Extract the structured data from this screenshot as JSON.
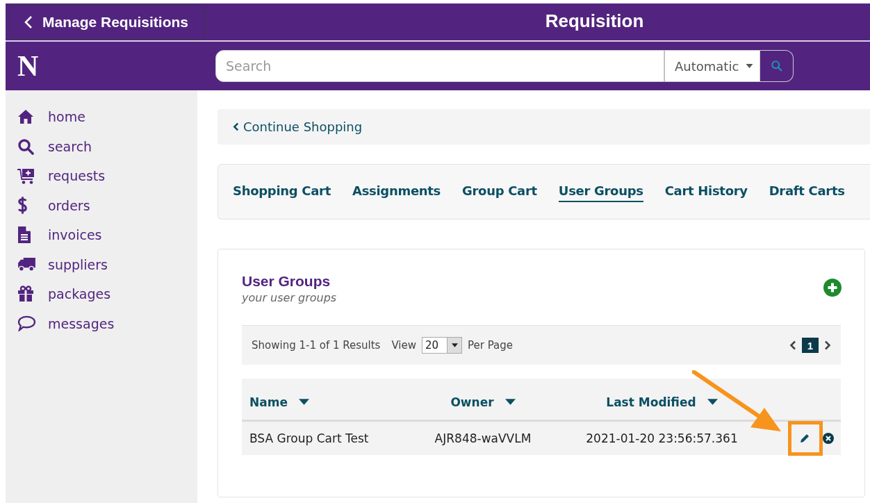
{
  "header": {
    "back_label": "Manage Requisitions",
    "title": "Requisition"
  },
  "logo": "N",
  "search": {
    "placeholder": "Search",
    "mode": "Automatic"
  },
  "sidebar": {
    "items": [
      {
        "label": "home",
        "kind": "home"
      },
      {
        "label": "search",
        "kind": "search"
      },
      {
        "label": "requests",
        "kind": "cart"
      },
      {
        "label": "orders",
        "kind": "dollar"
      },
      {
        "label": "invoices",
        "kind": "document"
      },
      {
        "label": "suppliers",
        "kind": "truck"
      },
      {
        "label": "packages",
        "kind": "gift"
      },
      {
        "label": "messages",
        "kind": "chat"
      }
    ]
  },
  "breadcrumb": "Continue Shopping",
  "tabs": [
    {
      "label": "Shopping Cart",
      "selected": false
    },
    {
      "label": "Assignments",
      "selected": false
    },
    {
      "label": "Group Cart",
      "selected": false
    },
    {
      "label": "User Groups",
      "selected": true
    },
    {
      "label": "Cart History",
      "selected": false
    },
    {
      "label": "Draft Carts",
      "selected": false
    }
  ],
  "panel": {
    "title": "User Groups",
    "subtitle": "your user groups"
  },
  "pager": {
    "summary": "Showing 1-1 of 1 Results",
    "view_label": "View",
    "per_page": "20",
    "per_page_label": "Per Page",
    "page": "1"
  },
  "table": {
    "columns": [
      "Name",
      "Owner",
      "Last Modified"
    ],
    "rows": [
      {
        "cells": [
          "BSA Group Cart Test",
          "AJR848-waVVLM",
          "2021-01-20 23:56:57.361"
        ],
        "highlighted": true
      }
    ]
  }
}
